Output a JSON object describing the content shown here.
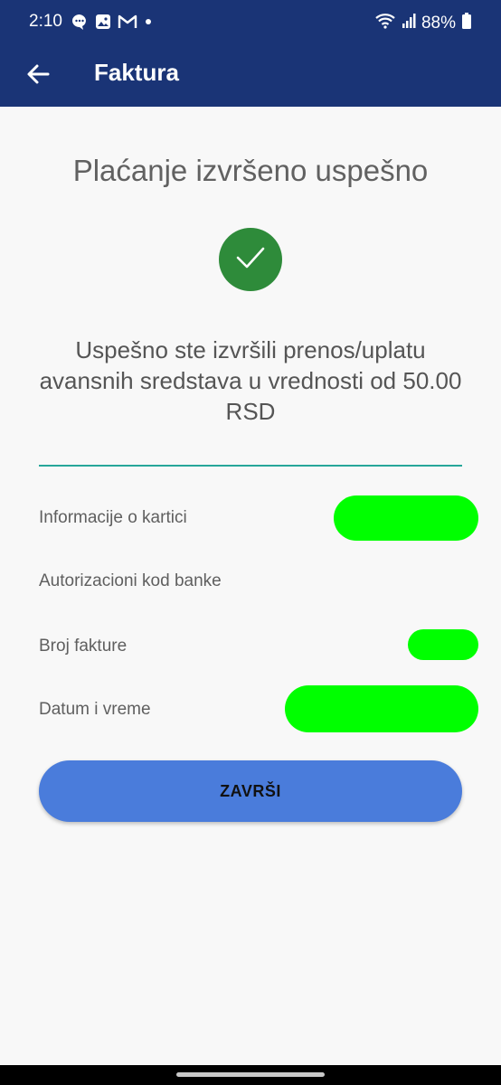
{
  "status_bar": {
    "time": "2:10",
    "battery": "88%",
    "notification_icons": [
      "chat-icon",
      "gallery-icon",
      "gmail-icon",
      "dot-icon"
    ]
  },
  "app_bar": {
    "title": "Faktura",
    "color": "#1a3476"
  },
  "main": {
    "heading": "Plaćanje izvršeno uspešno",
    "message": "Uspešno ste izvršili prenos/uplatu avansnih sredstava u vrednosti od 50.00 RSD",
    "success_color": "#2e8b3a",
    "details": [
      {
        "label": "Informacije o kartici",
        "value": ""
      },
      {
        "label": "Autorizacioni kod banke",
        "value": ""
      },
      {
        "label": "Broj fakture",
        "value": ""
      },
      {
        "label": "Datum i vreme",
        "value": ""
      }
    ],
    "finish_button": "ZAVRŠI",
    "button_color": "#4a7cdb",
    "divider_color": "#26a69a",
    "redaction_color": "#00ff00"
  }
}
